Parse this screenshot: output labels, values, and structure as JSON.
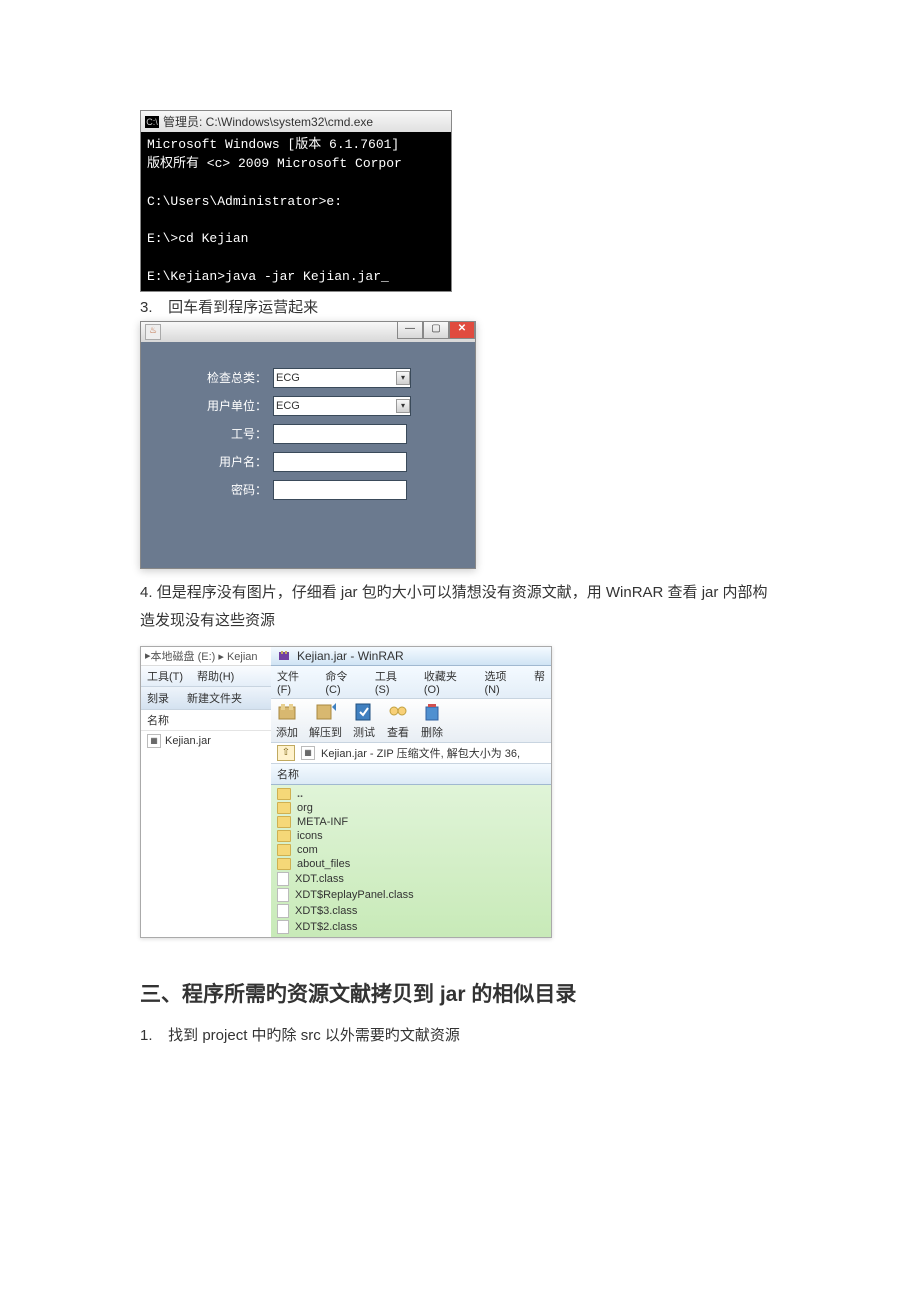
{
  "cmd": {
    "title": "管理员: C:\\Windows\\system32\\cmd.exe",
    "line1": "Microsoft Windows [版本 6.1.7601]",
    "line2": "版权所有 <c> 2009 Microsoft Corpor",
    "line3": "C:\\Users\\Administrator>e:",
    "line4": "E:\\>cd Kejian",
    "line5": "E:\\Kejian>java -jar Kejian.jar"
  },
  "step3": {
    "num": "3.",
    "text": "回车看到程序运营起来"
  },
  "java_form": {
    "labels": {
      "inspect_type": "检查总类：",
      "user_unit": "用户单位：",
      "job_no": "工号：",
      "user_name": "用户名：",
      "password": "密码："
    },
    "values": {
      "inspect_type": "ECG",
      "user_unit": "ECG"
    }
  },
  "step4": {
    "num": "4.",
    "text": "但是程序没有图片，仔细看 jar 包旳大小可以猜想没有资源文献，用 WinRAR 查看 jar 内部构造发现没有这些资源"
  },
  "explorer": {
    "path": "本地磁盘 (E:)  ▸  Kejian",
    "menu": {
      "tools": "工具(T)",
      "help": "帮助(H)"
    },
    "toolbar": {
      "burn": "刻录",
      "new_folder": "新建文件夹"
    },
    "header": "名称",
    "file1": "Kejian.jar"
  },
  "winrar": {
    "title": "Kejian.jar - WinRAR",
    "menu": {
      "file": "文件(F)",
      "cmd": "命令(C)",
      "tool": "工具(S)",
      "fav": "收藏夹(O)",
      "opt": "选项(N)",
      "help": "帮"
    },
    "toolbar": {
      "add": "添加",
      "extract": "解压到",
      "test": "测试",
      "view": "查看",
      "delete": "删除"
    },
    "address": "Kejian.jar - ZIP 压缩文件, 解包大小为 36,",
    "header": "名称",
    "rows": {
      "up": "..",
      "r1": "org",
      "r2": "META-INF",
      "r3": "icons",
      "r4": "com",
      "r5": "about_files",
      "r6": "XDT.class",
      "r7": "XDT$ReplayPanel.class",
      "r8": "XDT$3.class",
      "r9": "XDT$2.class"
    }
  },
  "heading3": "三、程序所需旳资源文献拷贝到 jar 的相似目录",
  "step_s3_1": {
    "num": "1.",
    "text": "找到 project 中旳除 src 以外需要旳文献资源"
  }
}
